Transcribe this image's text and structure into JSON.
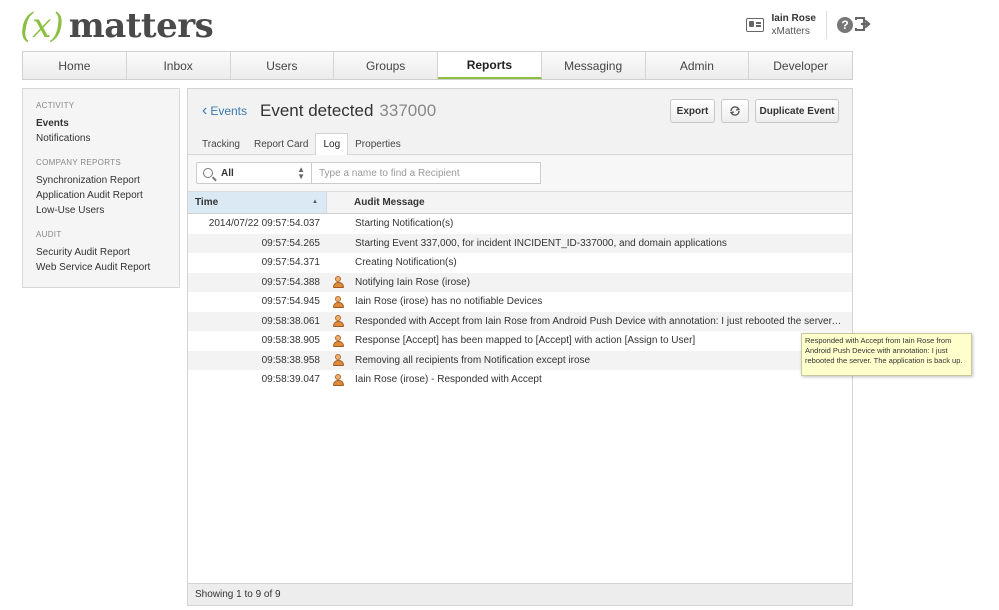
{
  "logo": {
    "x_mark": "(x)",
    "word": "matters"
  },
  "user": {
    "name": "Iain Rose",
    "org": "xMatters"
  },
  "nav": [
    {
      "label": "Home"
    },
    {
      "label": "Inbox"
    },
    {
      "label": "Users"
    },
    {
      "label": "Groups"
    },
    {
      "label": "Reports",
      "active": true
    },
    {
      "label": "Messaging"
    },
    {
      "label": "Admin"
    },
    {
      "label": "Developer"
    }
  ],
  "sidebar": {
    "activity_label": "ACTIVITY",
    "activity_items": [
      "Events",
      "Notifications"
    ],
    "company_label": "COMPANY REPORTS",
    "company_items": [
      "Synchronization Report",
      "Application Audit Report",
      "Low-Use Users"
    ],
    "audit_label": "AUDIT",
    "audit_items": [
      "Security Audit Report",
      "Web Service Audit Report"
    ]
  },
  "event": {
    "back_label": "Events",
    "title": "Event detected",
    "id": "337000",
    "export_label": "Export",
    "duplicate_label": "Duplicate Event"
  },
  "tabs": [
    "Tracking",
    "Report Card",
    "Log",
    "Properties"
  ],
  "filter": {
    "selected": "All",
    "placeholder": "Type a name to find a Recipient"
  },
  "grid": {
    "col_time": "Time",
    "col_message": "Audit Message",
    "rows": [
      {
        "time": "2014/07/22 09:57:54.037",
        "icon": false,
        "message": "Starting Notification(s)"
      },
      {
        "time": "09:57:54.265",
        "icon": false,
        "message": "Starting Event 337,000, for incident INCIDENT_ID-337000, and domain applications"
      },
      {
        "time": "09:57:54.371",
        "icon": false,
        "message": "Creating Notification(s)"
      },
      {
        "time": "09:57:54.388",
        "icon": true,
        "message": "Notifying Iain Rose (irose)"
      },
      {
        "time": "09:57:54.945",
        "icon": true,
        "message": "Iain Rose (irose) has no notifiable Devices"
      },
      {
        "time": "09:58:38.061",
        "icon": true,
        "message": "Responded with Accept from Iain Rose from Android Push Device with annotation: I just rebooted the server. The application is back up."
      },
      {
        "time": "09:58:38.905",
        "icon": true,
        "message": "Response [Accept] has been mapped to [Accept] with action [Assign to User]"
      },
      {
        "time": "09:58:38.958",
        "icon": true,
        "message": "Removing all recipients from Notification except irose"
      },
      {
        "time": "09:58:39.047",
        "icon": true,
        "message": "Iain Rose (irose) - Responded with Accept"
      }
    ]
  },
  "footer": {
    "showing": "Showing 1 to 9 of 9"
  },
  "tooltip": {
    "text": "Responded with Accept from Iain Rose from Android Push Device with annotation: I just rebooted the server. The application is back up."
  },
  "colors": {
    "brand_green": "#8bbf3f",
    "link_blue": "#3a7bb0",
    "sorted_column": "#dbe9f5",
    "tooltip_bg": "#ffffcc"
  }
}
